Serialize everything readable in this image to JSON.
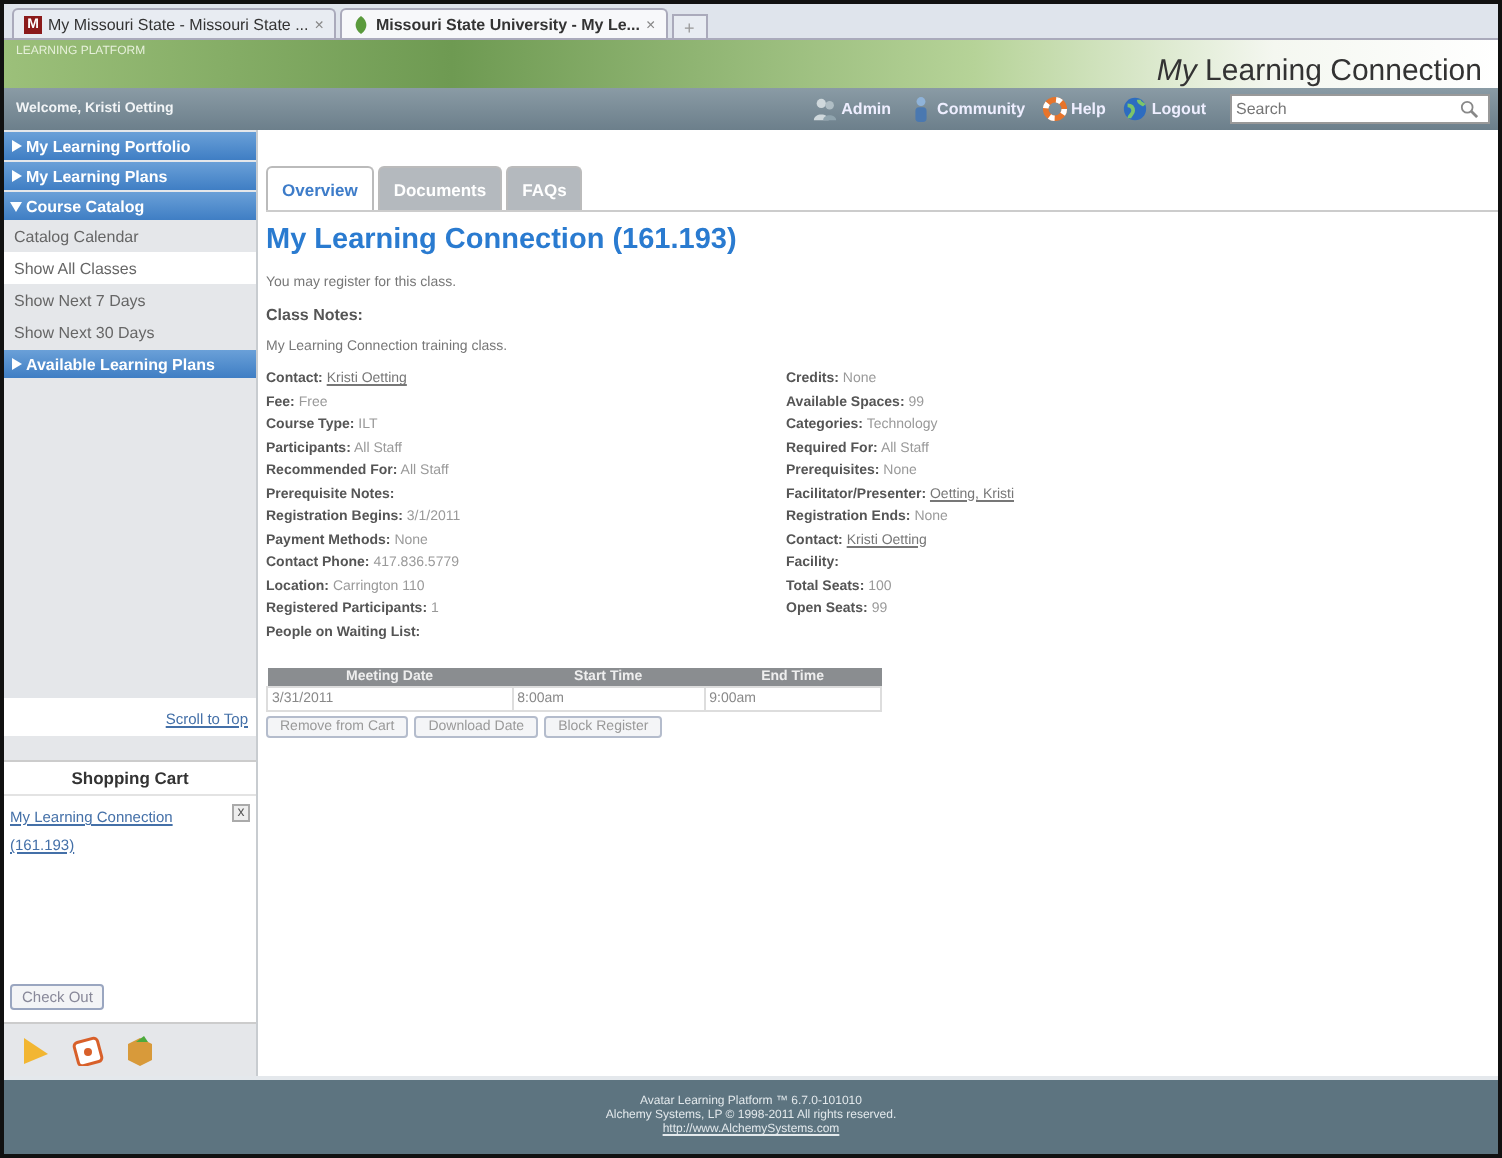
{
  "browser_tabs": [
    {
      "icon_letter": "M",
      "title": "My Missouri State - Missouri State ...",
      "close": "×",
      "selected": false
    },
    {
      "title": "Missouri State University - My Le...",
      "close": "×",
      "selected": true
    }
  ],
  "new_tab": "+",
  "header": {
    "platform_label": "LEARNING PLATFORM",
    "title": "*My* Learning Connection"
  },
  "nav": {
    "welcome": "Welcome, Kristi Oetting",
    "links": [
      {
        "kind": "admin",
        "label": "Admin"
      },
      {
        "kind": "community",
        "label": "Community"
      },
      {
        "kind": "help",
        "label": "Help"
      },
      {
        "kind": "logout",
        "label": "Logout"
      }
    ],
    "search": {
      "placeholder": "Search"
    }
  },
  "sidebar": {
    "menu": [
      {
        "label": "My Learning Portfolio",
        "expanded": false
      },
      {
        "label": "My Learning Plans",
        "expanded": false
      },
      {
        "label": "Course Catalog",
        "expanded": true,
        "children": [
          {
            "label": "Catalog Calendar",
            "selected": false
          },
          {
            "label": "Show All Classes",
            "selected": true
          },
          {
            "label": "Show Next 7 Days",
            "selected": false
          },
          {
            "label": "Show Next 30 Days",
            "selected": false
          }
        ]
      },
      {
        "label": "Available Learning Plans",
        "expanded": false
      }
    ],
    "scroll_link": "Scroll to Top",
    "cart": {
      "title": "Shopping Cart",
      "items": [
        {
          "name": "My Learning Connection (161.193)",
          "remove": "x"
        }
      ],
      "checkout": "Check Out"
    }
  },
  "content": {
    "tabs": [
      {
        "label": "Overview",
        "selected": true
      },
      {
        "label": "Documents",
        "selected": false
      },
      {
        "label": "FAQs",
        "selected": false
      }
    ],
    "title": "My Learning Connection (161.193)",
    "notice": "You may register for this class.",
    "notes_heading": "Class Notes:",
    "notes": "My Learning Connection training class.",
    "fields_left": [
      {
        "label": "Contact:",
        "value": "Kristi Oetting",
        "link": true
      },
      {
        "label": "Fee:",
        "value": "Free",
        "link": false
      },
      {
        "label": "Course Type:",
        "value": "ILT",
        "link": false
      },
      {
        "label": "Participants:",
        "value": "All Staff",
        "link": false
      },
      {
        "label": "Recommended For:",
        "value": "All Staff",
        "link": false
      },
      {
        "label": "Prerequisite Notes:"
      },
      {
        "label": "Registration Begins:",
        "value": "3/1/2011",
        "link": false
      },
      {
        "label": "Payment Methods:",
        "value": "None",
        "link": false
      },
      {
        "label": "Contact Phone:",
        "value": "417.836.5779",
        "link": false
      },
      {
        "label": "Location:",
        "value": "Carrington 110",
        "link": false
      },
      {
        "label": "Registered Participants:",
        "value": "1",
        "link": false
      },
      {
        "label": "People on Waiting List:"
      }
    ],
    "fields_right": [
      {
        "label": "Credits:",
        "value": "None",
        "link": false
      },
      {
        "label": "Available Spaces:",
        "value": "99",
        "link": false
      },
      {
        "label": "Categories:",
        "value": "Technology",
        "link": false
      },
      {
        "label": "Required For:",
        "value": "All Staff",
        "link": false
      },
      {
        "label": "Prerequisites:",
        "value": "None",
        "link": false
      },
      {
        "label": "Facilitator/Presenter:",
        "value": "Oetting, Kristi",
        "link": true
      },
      {
        "label": "Registration Ends:",
        "value": "None",
        "link": false
      },
      {
        "label": "Contact:",
        "value": "Kristi Oetting",
        "link": true
      },
      {
        "label": "Facility:"
      },
      {
        "label": "Total Seats:",
        "value": "100",
        "link": false
      },
      {
        "label": "Open Seats:",
        "value": "99",
        "link": false
      }
    ],
    "meetings": {
      "columns": [
        "Meeting Date",
        "Start Time",
        "End Time"
      ],
      "rows": [
        [
          "3/31/2011",
          "8:00am",
          "9:00am"
        ]
      ]
    },
    "buttons": [
      "Remove from Cart",
      "Download Date",
      "Block Register"
    ]
  },
  "footer": {
    "lines": [
      "Avatar Learning Platform ™ 6.7.0-101010",
      "Alchemy Systems, LP © 1998-2011 All rights reserved."
    ],
    "link": "http://www.AlchemySystems.com"
  }
}
